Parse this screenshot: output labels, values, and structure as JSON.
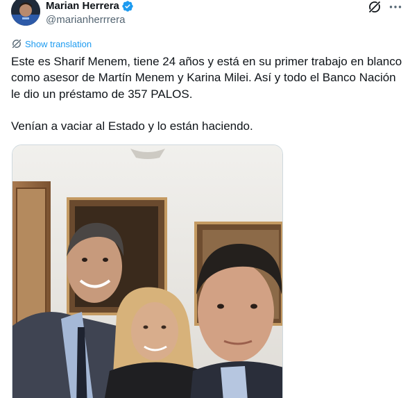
{
  "tweet": {
    "author": {
      "display_name": "Marian Herrera",
      "handle": "@marianherrrera",
      "verified": true
    },
    "translation_label": "Show translation",
    "text": "Este es Sharif Menem, tiene 24 años y está en su primer trabajo en blanco como asesor de Martín Menem y Karina Milei. Así y todo el Banco Nación le dio un préstamo de 357 PALOS.\n\nVenían a vaciar al Estado y lo están haciendo.",
    "media": {
      "type": "photo",
      "description_icon": "selfie-photo"
    }
  },
  "colors": {
    "accent": "#1d9bf0",
    "text": "#0f1419",
    "muted": "#536471"
  },
  "icons": [
    "verified-badge-icon",
    "grok-icon",
    "more-icon",
    "translate-icon"
  ]
}
